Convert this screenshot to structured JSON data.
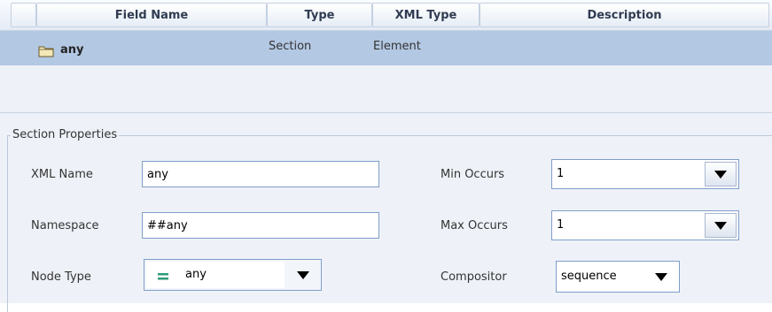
{
  "grid": {
    "columns": [
      "Field Name",
      "Type",
      "XML Type",
      "Description"
    ],
    "rows": [
      {
        "icon": "folder-icon",
        "field_name": "any",
        "type": "Section",
        "xml_type": "Element",
        "description": ""
      }
    ]
  },
  "section": {
    "legend": "Section Properties",
    "xml_name_label": "XML Name",
    "xml_name_value": "any",
    "namespace_label": "Namespace",
    "namespace_value": "##any",
    "node_type_label": "Node Type",
    "node_type_value": "any",
    "node_type_icon": "equals-icon",
    "min_occurs_label": "Min Occurs",
    "min_occurs_value": "1",
    "max_occurs_label": "Max Occurs",
    "max_occurs_value": "1",
    "compositor_label": "Compositor",
    "compositor_value": "sequence"
  },
  "colors": {
    "selected_row": "#b3c8e3",
    "panel_bg": "#eef2f8",
    "input_border": "#7f9dc9",
    "node_icon": "#2f9a7a"
  }
}
